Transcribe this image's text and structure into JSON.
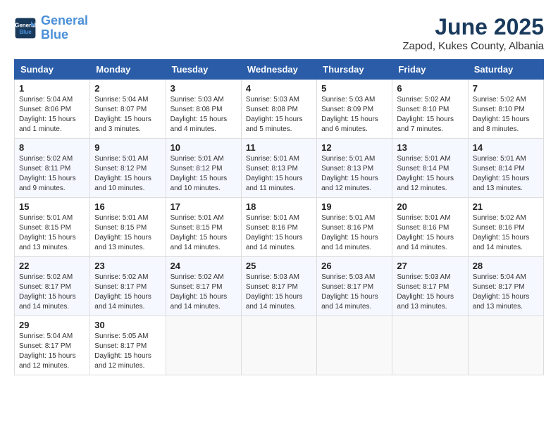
{
  "header": {
    "logo_line1": "General",
    "logo_line2": "Blue",
    "month": "June 2025",
    "location": "Zapod, Kukes County, Albania"
  },
  "weekdays": [
    "Sunday",
    "Monday",
    "Tuesday",
    "Wednesday",
    "Thursday",
    "Friday",
    "Saturday"
  ],
  "weeks": [
    [
      {
        "day": "1",
        "info": "Sunrise: 5:04 AM\nSunset: 8:06 PM\nDaylight: 15 hours\nand 1 minute."
      },
      {
        "day": "2",
        "info": "Sunrise: 5:04 AM\nSunset: 8:07 PM\nDaylight: 15 hours\nand 3 minutes."
      },
      {
        "day": "3",
        "info": "Sunrise: 5:03 AM\nSunset: 8:08 PM\nDaylight: 15 hours\nand 4 minutes."
      },
      {
        "day": "4",
        "info": "Sunrise: 5:03 AM\nSunset: 8:08 PM\nDaylight: 15 hours\nand 5 minutes."
      },
      {
        "day": "5",
        "info": "Sunrise: 5:03 AM\nSunset: 8:09 PM\nDaylight: 15 hours\nand 6 minutes."
      },
      {
        "day": "6",
        "info": "Sunrise: 5:02 AM\nSunset: 8:10 PM\nDaylight: 15 hours\nand 7 minutes."
      },
      {
        "day": "7",
        "info": "Sunrise: 5:02 AM\nSunset: 8:10 PM\nDaylight: 15 hours\nand 8 minutes."
      }
    ],
    [
      {
        "day": "8",
        "info": "Sunrise: 5:02 AM\nSunset: 8:11 PM\nDaylight: 15 hours\nand 9 minutes."
      },
      {
        "day": "9",
        "info": "Sunrise: 5:01 AM\nSunset: 8:12 PM\nDaylight: 15 hours\nand 10 minutes."
      },
      {
        "day": "10",
        "info": "Sunrise: 5:01 AM\nSunset: 8:12 PM\nDaylight: 15 hours\nand 10 minutes."
      },
      {
        "day": "11",
        "info": "Sunrise: 5:01 AM\nSunset: 8:13 PM\nDaylight: 15 hours\nand 11 minutes."
      },
      {
        "day": "12",
        "info": "Sunrise: 5:01 AM\nSunset: 8:13 PM\nDaylight: 15 hours\nand 12 minutes."
      },
      {
        "day": "13",
        "info": "Sunrise: 5:01 AM\nSunset: 8:14 PM\nDaylight: 15 hours\nand 12 minutes."
      },
      {
        "day": "14",
        "info": "Sunrise: 5:01 AM\nSunset: 8:14 PM\nDaylight: 15 hours\nand 13 minutes."
      }
    ],
    [
      {
        "day": "15",
        "info": "Sunrise: 5:01 AM\nSunset: 8:15 PM\nDaylight: 15 hours\nand 13 minutes."
      },
      {
        "day": "16",
        "info": "Sunrise: 5:01 AM\nSunset: 8:15 PM\nDaylight: 15 hours\nand 13 minutes."
      },
      {
        "day": "17",
        "info": "Sunrise: 5:01 AM\nSunset: 8:15 PM\nDaylight: 15 hours\nand 14 minutes."
      },
      {
        "day": "18",
        "info": "Sunrise: 5:01 AM\nSunset: 8:16 PM\nDaylight: 15 hours\nand 14 minutes."
      },
      {
        "day": "19",
        "info": "Sunrise: 5:01 AM\nSunset: 8:16 PM\nDaylight: 15 hours\nand 14 minutes."
      },
      {
        "day": "20",
        "info": "Sunrise: 5:01 AM\nSunset: 8:16 PM\nDaylight: 15 hours\nand 14 minutes."
      },
      {
        "day": "21",
        "info": "Sunrise: 5:02 AM\nSunset: 8:16 PM\nDaylight: 15 hours\nand 14 minutes."
      }
    ],
    [
      {
        "day": "22",
        "info": "Sunrise: 5:02 AM\nSunset: 8:17 PM\nDaylight: 15 hours\nand 14 minutes."
      },
      {
        "day": "23",
        "info": "Sunrise: 5:02 AM\nSunset: 8:17 PM\nDaylight: 15 hours\nand 14 minutes."
      },
      {
        "day": "24",
        "info": "Sunrise: 5:02 AM\nSunset: 8:17 PM\nDaylight: 15 hours\nand 14 minutes."
      },
      {
        "day": "25",
        "info": "Sunrise: 5:03 AM\nSunset: 8:17 PM\nDaylight: 15 hours\nand 14 minutes."
      },
      {
        "day": "26",
        "info": "Sunrise: 5:03 AM\nSunset: 8:17 PM\nDaylight: 15 hours\nand 14 minutes."
      },
      {
        "day": "27",
        "info": "Sunrise: 5:03 AM\nSunset: 8:17 PM\nDaylight: 15 hours\nand 13 minutes."
      },
      {
        "day": "28",
        "info": "Sunrise: 5:04 AM\nSunset: 8:17 PM\nDaylight: 15 hours\nand 13 minutes."
      }
    ],
    [
      {
        "day": "29",
        "info": "Sunrise: 5:04 AM\nSunset: 8:17 PM\nDaylight: 15 hours\nand 12 minutes."
      },
      {
        "day": "30",
        "info": "Sunrise: 5:05 AM\nSunset: 8:17 PM\nDaylight: 15 hours\nand 12 minutes."
      },
      {
        "day": "",
        "info": ""
      },
      {
        "day": "",
        "info": ""
      },
      {
        "day": "",
        "info": ""
      },
      {
        "day": "",
        "info": ""
      },
      {
        "day": "",
        "info": ""
      }
    ]
  ]
}
